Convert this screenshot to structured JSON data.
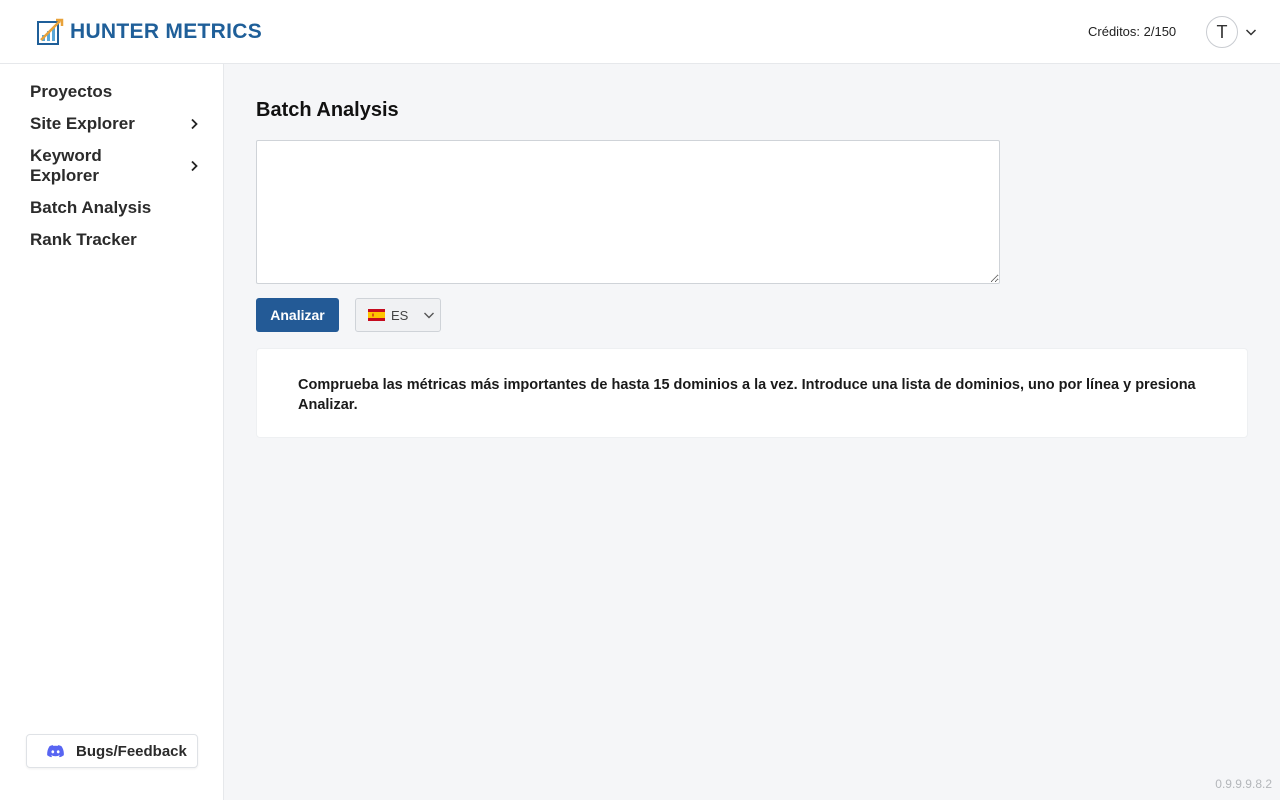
{
  "header": {
    "brand": "HUNTER METRICS",
    "credits": "Créditos: 2/150",
    "user_initial": "T"
  },
  "sidebar": {
    "items": [
      {
        "label": "Proyectos",
        "has_submenu": false
      },
      {
        "label": "Site Explorer",
        "has_submenu": true
      },
      {
        "label": "Keyword Explorer",
        "has_submenu": true
      },
      {
        "label": "Batch Analysis",
        "has_submenu": false
      },
      {
        "label": "Rank Tracker",
        "has_submenu": false
      }
    ],
    "feedback_label": "Bugs/Feedback"
  },
  "main": {
    "title": "Batch Analysis",
    "input": {
      "value": "",
      "placeholder": ""
    },
    "analyze_label": "Analizar",
    "language": {
      "code": "ES",
      "flag": "spain-flag-icon"
    },
    "info_text": "Comprueba las métricas más importantes de hasta 15 dominios a la vez. Introduce una lista de dominios, uno por línea y presiona Analizar."
  },
  "version": "0.9.9.9.8.2",
  "colors": {
    "brand": "#1f5f99",
    "primary_button": "#235a96",
    "background": "#f5f6f8",
    "discord": "#5865f2"
  }
}
